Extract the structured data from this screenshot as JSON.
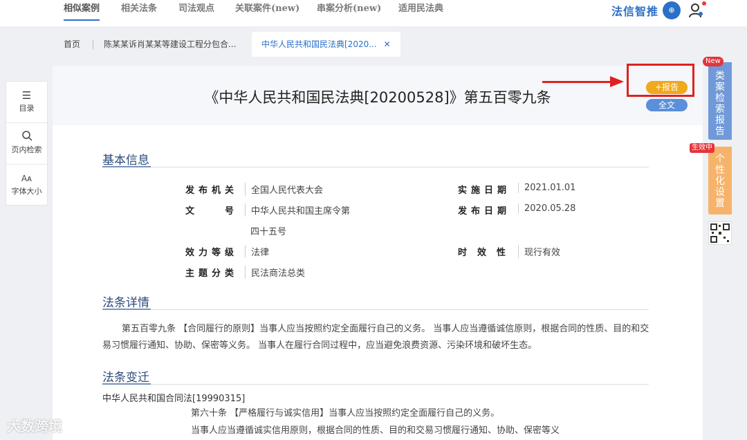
{
  "nav": {
    "tabs": [
      "相似案例",
      "相关法条",
      "司法观点",
      "关联案件(new)",
      "串案分析(new)",
      "适用民法典"
    ],
    "brand": "法信智推"
  },
  "breadcrumbs": {
    "home": "首页",
    "tab1": "陈某某诉肖某某等建设工程分包合...",
    "tab2": "中华人民共和国民法典[2020..."
  },
  "tools": [
    {
      "icon": "menu-icon",
      "label": "目录"
    },
    {
      "icon": "search-icon",
      "label": "页内检索"
    },
    {
      "icon": "font-size-icon",
      "label": "字体大小"
    }
  ],
  "document": {
    "title": "《中华人民共和国民法典[20200528]》第五百零九条",
    "report_btn": "+报告",
    "full_btn": "全文"
  },
  "basic_info": {
    "heading": "基本信息",
    "issuer_label": "发布机关",
    "issuer": "全国人民代表大会",
    "docno_label": "文号",
    "docno_line1": "中华人民共和国主席令第",
    "docno_line2": "四十五号",
    "level_label": "效力等级",
    "level": "法律",
    "topic_label": "主题分类",
    "topic": "民法商法总类",
    "effective_label": "实施日期",
    "effective": "2021.01.01",
    "publish_label": "发布日期",
    "publish": "2020.05.28",
    "validity_label": "时效性",
    "validity": "现行有效"
  },
  "detail": {
    "heading": "法条详情",
    "text": "第五百零九条 【合同履行的原则】当事人应当按照约定全面履行自己的义务。 当事人应当遵循诚信原则，根据合同的性质、目的和交易习惯履行通知、协助、保密等义务。 当事人在履行合同过程中，应当避免浪费资源、污染环境和破坏生态。"
  },
  "history": {
    "heading": "法条变迁",
    "source": "中华人民共和国合同法[19990315]",
    "line1": "第六十条 【严格履行与诚实信用】当事人应当按照约定全面履行自己的义务。",
    "line2": "当事人应当遵循诚实信用原则，根据合同的性质、目的和交易习惯履行通知、协助、保密等义"
  },
  "right_float": {
    "new_badge": "New",
    "report_label": "类案检索报告",
    "active_badge": "生效中",
    "personal_label": "个性化设置"
  },
  "watermark": "大数跨境"
}
